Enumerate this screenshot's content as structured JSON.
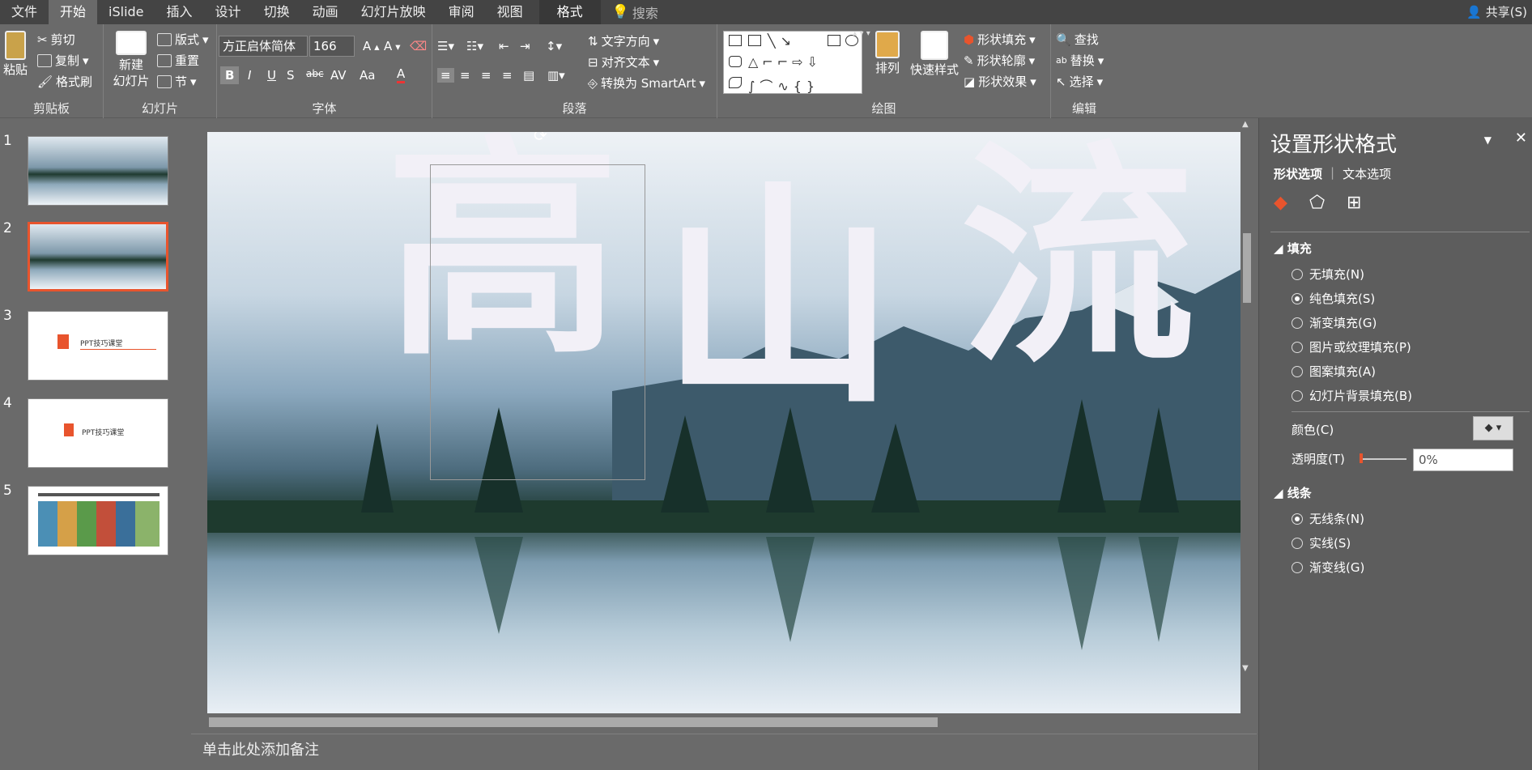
{
  "tabs": [
    "文件",
    "开始",
    "iSlide",
    "插入",
    "设计",
    "切换",
    "动画",
    "幻灯片放映",
    "审阅",
    "视图",
    "格式"
  ],
  "active_tab": "开始",
  "tellme": "搜索",
  "share": "共享(S)",
  "clipboard": {
    "paste": "粘贴",
    "cut": "剪切",
    "copy": "复制",
    "painter": "格式刷",
    "label": "剪贴板"
  },
  "slides_grp": {
    "new": "新建",
    "new2": "幻灯片",
    "layout": "版式",
    "reset": "重置",
    "section": "节",
    "label": "幻灯片"
  },
  "font": {
    "name": "方正启体简体",
    "size": "166",
    "label": "字体",
    "bold": "B",
    "italic": "I",
    "underline": "U",
    "shadow": "S",
    "strike": "abc",
    "spacing": "AV",
    "case": "Aa",
    "color": "A"
  },
  "para": {
    "text_dir": "文字方向",
    "align_text": "对齐文本",
    "smartart": "转换为 SmartArt",
    "label": "段落"
  },
  "draw": {
    "arrange": "排列",
    "quick": "快速样式",
    "fill": "形状填充",
    "outline": "形状轮廓",
    "effects": "形状效果",
    "label": "绘图"
  },
  "edit": {
    "find": "查找",
    "replace": "替换",
    "select": "选择",
    "label": "编辑"
  },
  "thumbs": [
    "1",
    "2",
    "3",
    "4",
    "5"
  ],
  "thumb_text": "PPT技巧课堂",
  "slide_title_chars": [
    "高",
    "山",
    "流"
  ],
  "notes": "单击此处添加备注",
  "panel": {
    "title": "设置形状格式",
    "tab1": "形状选项",
    "tab2": "文本选项",
    "fill": "填充",
    "fill_opts": [
      "无填充(N)",
      "纯色填充(S)",
      "渐变填充(G)",
      "图片或纹理填充(P)",
      "图案填充(A)",
      "幻灯片背景填充(B)"
    ],
    "color": "颜色(C)",
    "transp": "透明度(T)",
    "transp_val": "0%",
    "line": "线条",
    "line_opts": [
      "无线条(N)",
      "实线(S)",
      "渐变线(G)"
    ]
  },
  "colors": {
    "accent": "#e8542d"
  }
}
